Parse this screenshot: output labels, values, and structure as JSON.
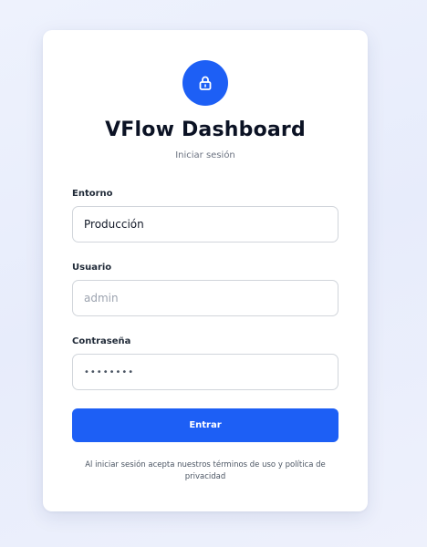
{
  "login": {
    "title": "VFlow Dashboard",
    "subtitle": "Iniciar sesión",
    "lock_icon": "lock-icon",
    "accent_color": "#1d5ff5",
    "fields": {
      "environment": {
        "label": "Entorno",
        "value": "Producción"
      },
      "username": {
        "label": "Usuario",
        "value": "",
        "placeholder": "admin"
      },
      "password": {
        "label": "Contraseña",
        "value": "••••••••"
      }
    },
    "submit_label": "Entrar",
    "legal_text": "Al iniciar sesión acepta nuestros términos de uso y política de privacidad"
  }
}
